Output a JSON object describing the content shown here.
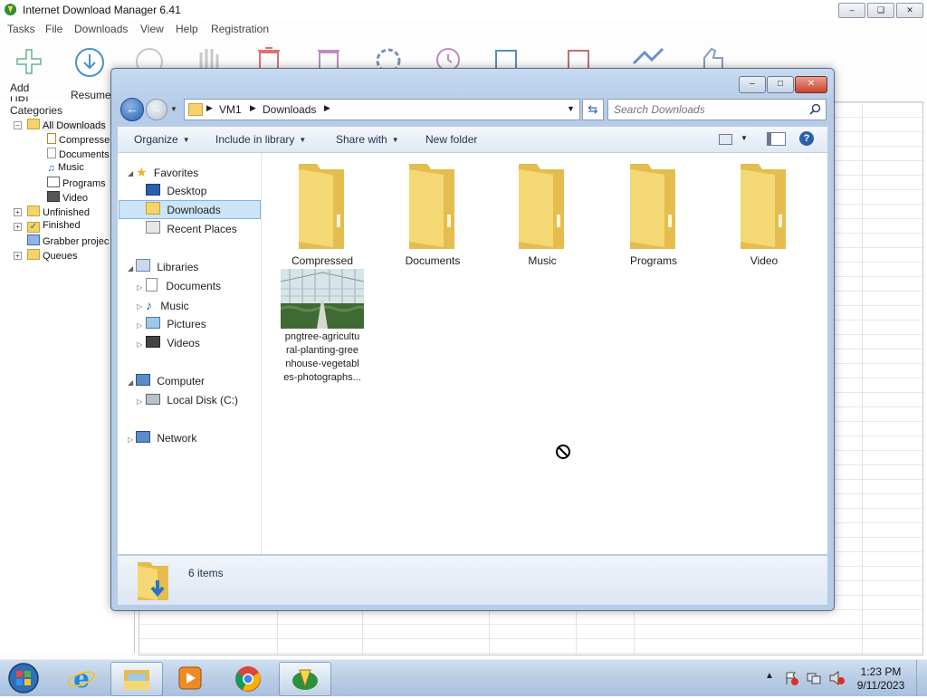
{
  "idm": {
    "title": "Internet Download Manager 6.41",
    "menu": [
      "Tasks",
      "File",
      "Downloads",
      "View",
      "Help",
      "Registration"
    ],
    "toolbar": {
      "add_url": "Add URL",
      "resume": "Resume"
    },
    "categories": {
      "header": "Categories",
      "items": [
        {
          "label": "All Downloads",
          "icon": "folder-open-icon"
        },
        {
          "label": "Compresse",
          "icon": "zip-icon"
        },
        {
          "label": "Documents",
          "icon": "document-icon"
        },
        {
          "label": "Music",
          "icon": "music-note-icon"
        },
        {
          "label": "Programs",
          "icon": "program-window-icon"
        },
        {
          "label": "Video",
          "icon": "film-icon"
        },
        {
          "label": "Unfinished",
          "icon": "folder-download-icon"
        },
        {
          "label": "Finished",
          "icon": "folder-check-icon"
        },
        {
          "label": "Grabber projec",
          "icon": "grabber-icon"
        },
        {
          "label": "Queues",
          "icon": "folder-icon"
        }
      ]
    }
  },
  "explorer": {
    "breadcrumb": [
      "VM1",
      "Downloads"
    ],
    "search_placeholder": "Search Downloads",
    "commands": {
      "organize": "Organize",
      "include_in_library": "Include in library",
      "share_with": "Share with",
      "new_folder": "New folder"
    },
    "nav": {
      "favorites": "Favorites",
      "desktop": "Desktop",
      "downloads": "Downloads",
      "recent_places": "Recent Places",
      "libraries": "Libraries",
      "lib_documents": "Documents",
      "lib_music": "Music",
      "lib_pictures": "Pictures",
      "lib_videos": "Videos",
      "computer": "Computer",
      "local_disk": "Local Disk (C:)",
      "network": "Network"
    },
    "items": [
      {
        "name": "Compressed",
        "type": "folder"
      },
      {
        "name": "Documents",
        "type": "folder"
      },
      {
        "name": "Music",
        "type": "folder"
      },
      {
        "name": "Programs",
        "type": "folder"
      },
      {
        "name": "Video",
        "type": "folder"
      }
    ],
    "image_file": {
      "name_lines": [
        "pngtree-agricultu",
        "ral-planting-gree",
        "nhouse-vegetabl",
        "es-photographs..."
      ]
    },
    "status": {
      "item_count": "6 items"
    }
  },
  "taskbar": {
    "time": "1:23 PM",
    "date": "9/11/2023",
    "apps": [
      "start-orb-icon",
      "internet-explorer-icon",
      "explorer-folder-icon",
      "media-player-icon",
      "chrome-icon",
      "idm-icon"
    ]
  },
  "colors": {
    "folder_yellow": "#f2d675",
    "win7_blue": "#2a5fad",
    "close_red": "#c7432b"
  }
}
